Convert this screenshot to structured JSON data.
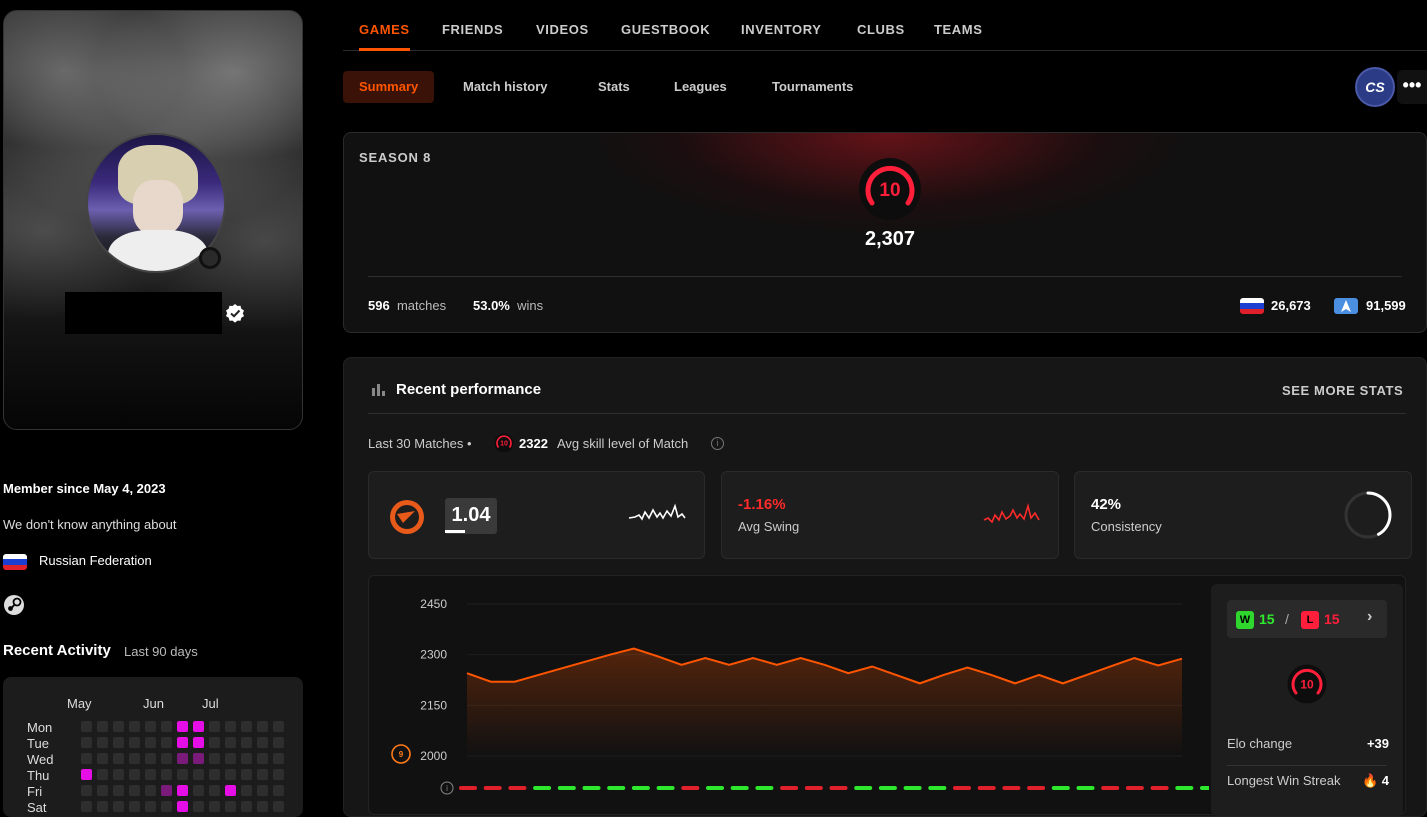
{
  "profile": {
    "member_since": "Member since May 4, 2023",
    "bio": "We don't know anything about",
    "country": "Russian Federation"
  },
  "activity": {
    "title": "Recent Activity",
    "subtitle": "Last 90 days",
    "months": [
      "May",
      "Jun",
      "Jul"
    ],
    "days": [
      "Mon",
      "Tue",
      "Wed",
      "Thu",
      "Fri",
      "Sat"
    ],
    "colors": {
      "empty": "#2e2e2e",
      "high": "#e60ee6",
      "low": "#7a1a7a"
    }
  },
  "top_nav": [
    "GAMES",
    "FRIENDS",
    "VIDEOS",
    "GUESTBOOK",
    "INVENTORY",
    "CLUBS",
    "TEAMS"
  ],
  "sub_nav": [
    "Summary",
    "Match history",
    "Stats",
    "Leagues",
    "Tournaments"
  ],
  "game_logo": "CS",
  "more": "•••",
  "season": {
    "title": "SEASON 8",
    "level": "10",
    "elo": "2,307",
    "matches": "596",
    "matches_label": "matches",
    "wins": "53.0%",
    "wins_label": "wins",
    "country_rank": "26,673",
    "region_rank": "91,599"
  },
  "performance": {
    "title": "Recent performance",
    "see_more": "SEE MORE STATS",
    "last_matches": "Last 30 Matches •",
    "avg_skill_level": "10",
    "avg_skill": "2322",
    "avg_skill_label": "Avg skill level of Match",
    "kd": "1.04",
    "swing_value": "-1.16%",
    "swing_label": "Avg Swing",
    "consistency_value": "42%",
    "consistency_label": "Consistency",
    "consistency_fraction": 0.42
  },
  "chart_data": {
    "type": "area",
    "y_ticks": [
      "2450",
      "2300",
      "2150",
      "2000"
    ],
    "ylim": [
      2000,
      2450
    ],
    "values": [
      2245,
      2220,
      2220,
      2240,
      2260,
      2280,
      2300,
      2318,
      2295,
      2270,
      2290,
      2270,
      2290,
      2270,
      2290,
      2270,
      2245,
      2265,
      2240,
      2215,
      2240,
      2262,
      2240,
      2215,
      2240,
      2215,
      2240,
      2265,
      2290,
      2268,
      2288
    ],
    "results": [
      "L",
      "L",
      "L",
      "W",
      "W",
      "W",
      "W",
      "W",
      "W",
      "L",
      "W",
      "W",
      "W",
      "L",
      "L",
      "L",
      "W",
      "W",
      "W",
      "W",
      "L",
      "L",
      "L",
      "L",
      "W",
      "W",
      "L",
      "L",
      "L",
      "W",
      "W"
    ],
    "line_color": "#ff5500",
    "win_color": "#2ee82e",
    "loss_color": "#e0202a",
    "level_badge": "9"
  },
  "side_panel": {
    "wins": "15",
    "losses": "15",
    "win_letter": "W",
    "loss_letter": "L",
    "separator": "/",
    "chevron": "›",
    "level": "10",
    "elo_change_label": "Elo change",
    "elo_change": "+39",
    "streak_label": "Longest Win Streak",
    "streak": "4"
  }
}
